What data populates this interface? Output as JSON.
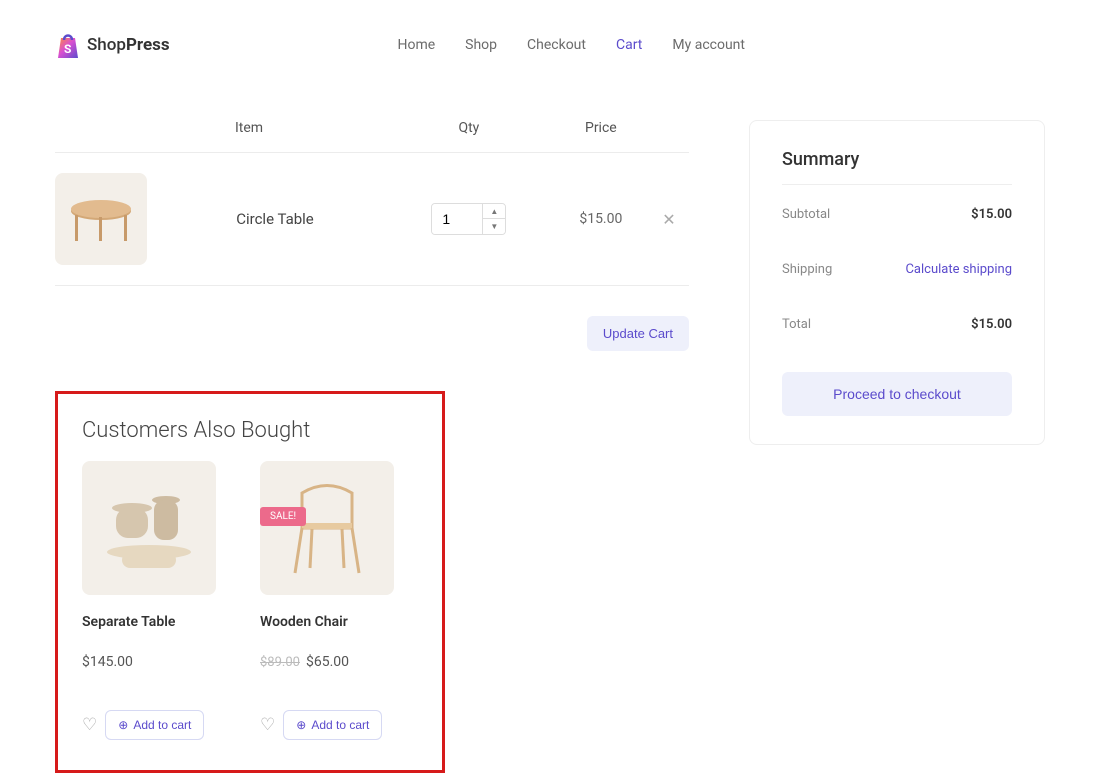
{
  "brand": {
    "name_a": "Shop",
    "name_b": "Press"
  },
  "nav": {
    "items": [
      {
        "label": "Home",
        "active": false
      },
      {
        "label": "Shop",
        "active": false
      },
      {
        "label": "Checkout",
        "active": false
      },
      {
        "label": "Cart",
        "active": true
      },
      {
        "label": "My account",
        "active": false
      }
    ]
  },
  "cart": {
    "headers": {
      "item": "Item",
      "qty": "Qty",
      "price": "Price"
    },
    "items": [
      {
        "name": "Circle Table",
        "qty": "1",
        "price": "$15.00"
      }
    ],
    "update_label": "Update Cart"
  },
  "cross_sell": {
    "title": "Customers Also Bought",
    "sale_badge": "SALE!",
    "add_label": "Add to cart",
    "products": [
      {
        "name": "Separate Table",
        "price": "$145.00",
        "old_price": "",
        "sale": false
      },
      {
        "name": "Wooden Chair",
        "price": "$65.00",
        "old_price": "$89.00",
        "sale": true
      }
    ]
  },
  "summary": {
    "title": "Summary",
    "subtotal_label": "Subtotal",
    "subtotal_value": "$15.00",
    "shipping_label": "Shipping",
    "shipping_link": "Calculate shipping",
    "total_label": "Total",
    "total_value": "$15.00",
    "checkout_label": "Proceed to checkout"
  }
}
